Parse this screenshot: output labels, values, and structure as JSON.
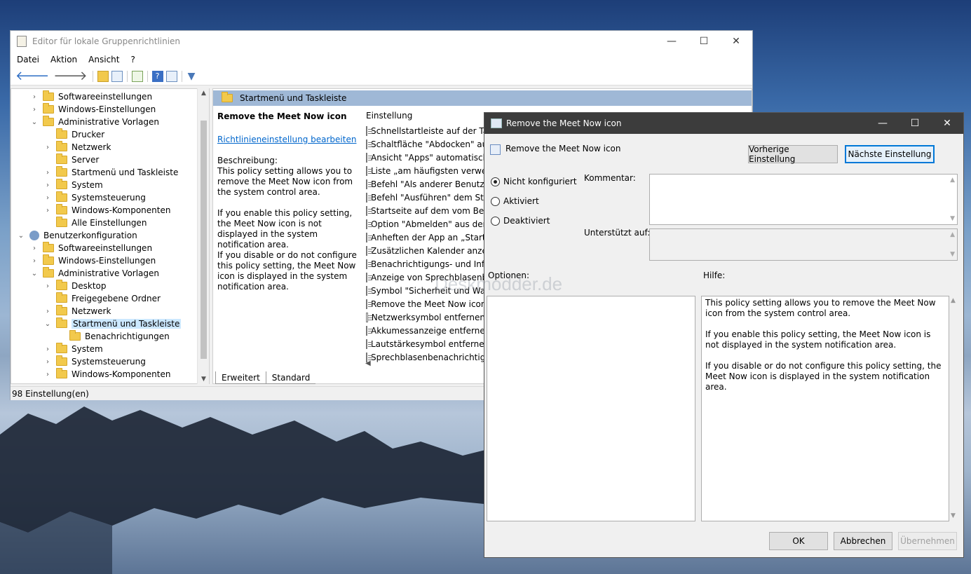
{
  "editor": {
    "title": "Editor für lokale Gruppenrichtlinien",
    "menu": [
      "Datei",
      "Aktion",
      "Ansicht",
      "?"
    ],
    "tree": [
      {
        "label": "Softwareeinstellungen",
        "arrow": "›",
        "kind": "folder"
      },
      {
        "label": "Windows-Einstellungen",
        "arrow": "›",
        "kind": "folder"
      },
      {
        "label": "Administrative Vorlagen",
        "arrow": "⌄",
        "kind": "folder"
      },
      {
        "label": "Drucker",
        "arrow": "",
        "kind": "folder"
      },
      {
        "label": "Netzwerk",
        "arrow": "›",
        "kind": "folder"
      },
      {
        "label": "Server",
        "arrow": "",
        "kind": "folder"
      },
      {
        "label": "Startmenü und Taskleiste",
        "arrow": "›",
        "kind": "folder"
      },
      {
        "label": "System",
        "arrow": "›",
        "kind": "folder"
      },
      {
        "label": "Systemsteuerung",
        "arrow": "›",
        "kind": "folder"
      },
      {
        "label": "Windows-Komponenten",
        "arrow": "›",
        "kind": "folder"
      },
      {
        "label": "Alle Einstellungen",
        "arrow": "",
        "kind": "folder"
      },
      {
        "label": "Benutzerkonfiguration",
        "arrow": "⌄",
        "kind": "user"
      },
      {
        "label": "Softwareeinstellungen",
        "arrow": "›",
        "kind": "folder"
      },
      {
        "label": "Windows-Einstellungen",
        "arrow": "›",
        "kind": "folder"
      },
      {
        "label": "Administrative Vorlagen",
        "arrow": "⌄",
        "kind": "folder"
      },
      {
        "label": "Desktop",
        "arrow": "›",
        "kind": "folder"
      },
      {
        "label": "Freigegebene Ordner",
        "arrow": "",
        "kind": "folder"
      },
      {
        "label": "Netzwerk",
        "arrow": "›",
        "kind": "folder"
      },
      {
        "label": "Startmenü und Taskleiste",
        "arrow": "⌄",
        "kind": "folder",
        "selected": true
      },
      {
        "label": "Benachrichtigungen",
        "arrow": "",
        "kind": "folder"
      },
      {
        "label": "System",
        "arrow": "›",
        "kind": "folder"
      },
      {
        "label": "Systemsteuerung",
        "arrow": "›",
        "kind": "folder"
      },
      {
        "label": "Windows-Komponenten",
        "arrow": "›",
        "kind": "folder"
      }
    ],
    "section_header": "Startmenü und Taskleiste",
    "detail": {
      "title": "Remove the Meet Now icon",
      "link": "Richtlinieneinstellung bearbeiten",
      "desc_label": "Beschreibung:",
      "p1": "This policy setting allows you to remove the Meet Now icon from the system control area.",
      "p2": "If you enable this policy setting, the Meet Now icon is not displayed in the system notification area.",
      "p3": "If you disable or do not configure this policy setting, the Meet Now icon is displayed in the system notification area."
    },
    "list_header": "Einstellung",
    "list": [
      "Schnellstartleiste auf der Taskleiste",
      "Schaltfläche \"Abdocken\" aus",
      "Ansicht \"Apps\" automatisch",
      "Liste „am häufigsten verwendet",
      "Befehl \"Als anderer Benutzer",
      "Befehl \"Ausführen\" dem Start",
      "Startseite auf dem vom Benutzer",
      "Option \"Abmelden\" aus dem",
      "Anheften der App an „Start“",
      "Zusätzlichen Kalender anzeigen",
      "Benachrichtigungs- und Info",
      "Anzeige von Sprechblasenbe",
      "Symbol \"Sicherheit und Wartung",
      "Remove the Meet Now icon",
      "Netzwerksymbol entfernen",
      "Akkumessanzeige entfernen",
      "Lautstärkesymbol entfernen",
      "Sprechblasenbenachrichtigun"
    ],
    "tabs": [
      "Erweitert",
      "Standard"
    ],
    "status": "98 Einstellung(en)"
  },
  "dialog": {
    "title": "Remove the Meet Now icon",
    "policy_name": "Remove the Meet Now icon",
    "prev_button": "Vorherige Einstellung",
    "next_button": "Nächste Einstellung",
    "radios": [
      "Nicht konfiguriert",
      "Aktiviert",
      "Deaktiviert"
    ],
    "comment_label": "Kommentar:",
    "supported_label": "Unterstützt auf:",
    "options_label": "Optionen:",
    "help_label": "Hilfe:",
    "help_p1": "This policy setting allows you to remove the Meet Now icon from the system control area.",
    "help_p2": "If you enable this policy setting, the Meet Now icon is not displayed in the system notification area.",
    "help_p3": "If you disable or do not configure this policy setting, the Meet Now icon is displayed in the system notification area.",
    "ok": "OK",
    "cancel": "Abbrechen",
    "apply": "Übernehmen"
  },
  "watermark": "Deskmodder.de",
  "colors": {
    "selection": "#cce8ff",
    "header_band": "#9fb8d6",
    "link": "#0066cc",
    "dialog_titlebar": "#3c3c3c"
  }
}
